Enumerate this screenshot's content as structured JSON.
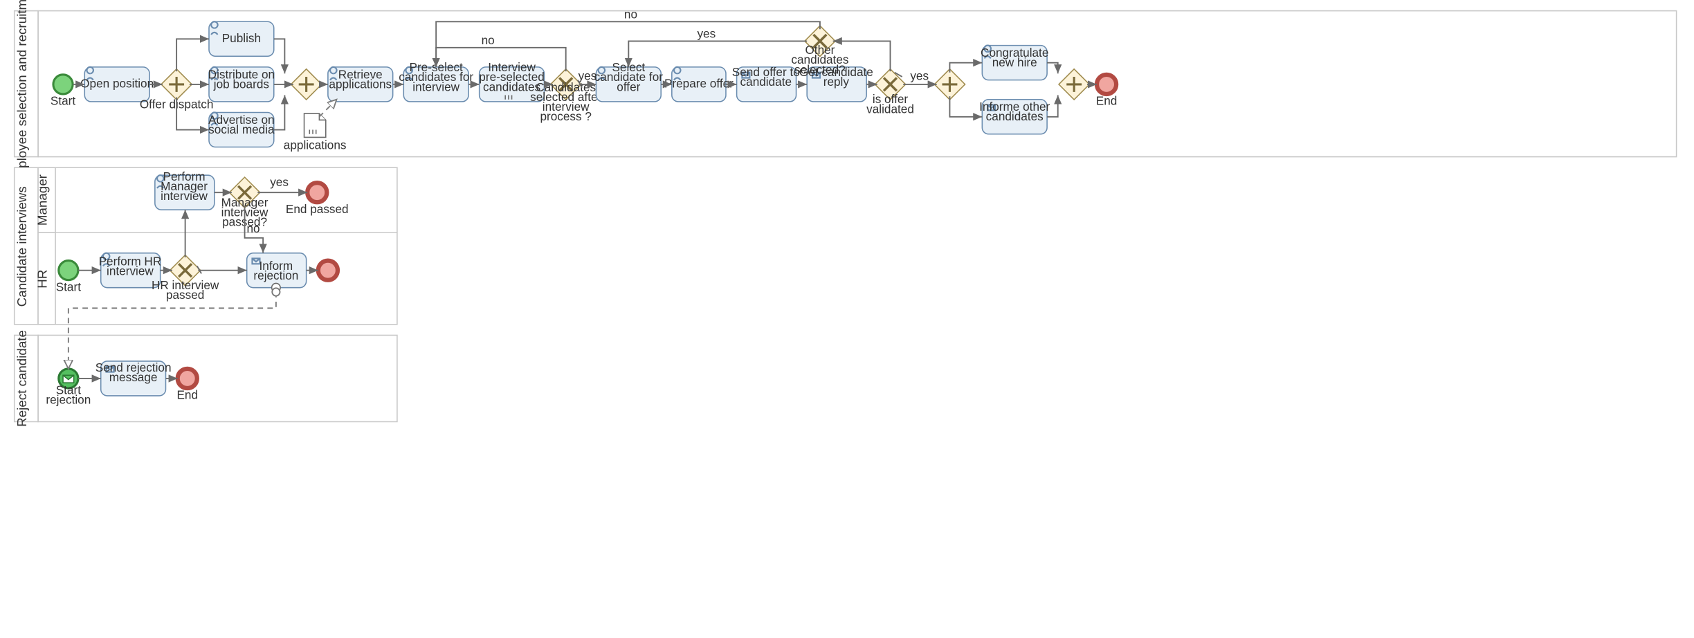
{
  "pools": {
    "p1": {
      "title": "Employee selection and recruitment"
    },
    "p2": {
      "title": "Candidate interviews",
      "lanes": {
        "l1": "Manager",
        "l2": "HR"
      }
    },
    "p3": {
      "title": "Reject candidate"
    }
  },
  "p1": {
    "start": "Start",
    "open_position": "Open position",
    "offer_dispatch": "Offer dispatch",
    "publish": "Publish",
    "distribute": "Distribute on job boards",
    "advertise": "Advertise on social media",
    "retrieve": "Retrieve applications",
    "applications": "applications",
    "preselect": "Pre-select candidates for interview",
    "interview_pre": "Interview pre-selected candidates",
    "gw_candidates_sel": "Candidates selected after interview process ?",
    "gw_candidates_sel_yes": "yes",
    "gw_candidates_sel_no": "no",
    "select_for_offer": "Select candidate for offer",
    "prepare_offer": "Prepare offer",
    "send_offer": "Send offer to candidate",
    "get_reply": "Get candidate reply",
    "gw_other_sel": "Other candidates selected?",
    "gw_other_sel_no": "no",
    "gw_other_sel_yes": "yes",
    "gw_offer_valid": "is offer validated",
    "gw_offer_valid_yes": "yes",
    "congratulate": "Congratulate new hire",
    "inform_other": "Informe other candidates",
    "end": "End"
  },
  "p2": {
    "start": "Start",
    "perform_hr": "Perform HR interview",
    "gw_hr": "HR interview passed",
    "perform_mgr": "Perform Manager interview",
    "gw_mgr": "Manager interview passed?",
    "gw_mgr_yes": "yes",
    "gw_mgr_no": "no",
    "inform_rejection": "Inform rejection",
    "end_passed": "End passed"
  },
  "p3": {
    "start_rejection": "Start rejection",
    "send_rejection": "Send rejection message",
    "end": "End"
  }
}
